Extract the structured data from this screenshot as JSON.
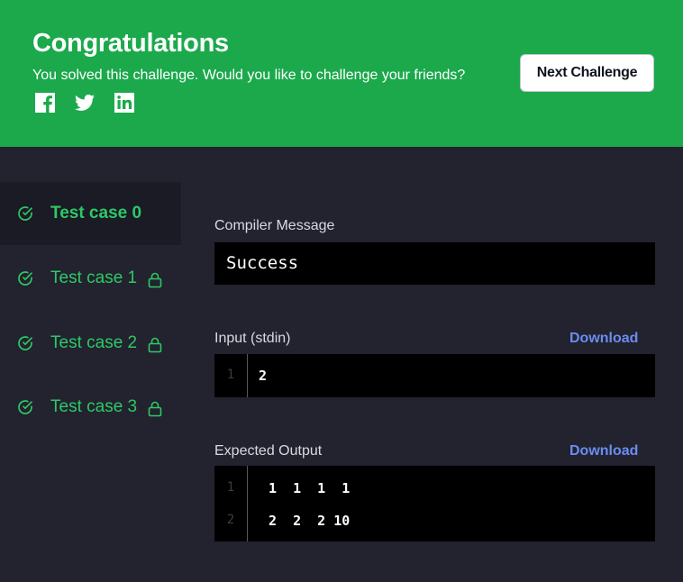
{
  "banner": {
    "title": "Congratulations",
    "subtitle": "You solved this challenge. Would you like to challenge your friends?",
    "share": [
      "facebook-icon",
      "twitter-icon",
      "linkedin-icon"
    ],
    "next_button": "Next Challenge",
    "color": "#1ba94c"
  },
  "test_cases": [
    {
      "label": "Test case 0",
      "locked": false,
      "passed": true
    },
    {
      "label": "Test case 1",
      "locked": true,
      "passed": true
    },
    {
      "label": "Test case 2",
      "locked": true,
      "passed": true
    },
    {
      "label": "Test case 3",
      "locked": true,
      "passed": true
    }
  ],
  "compiler": {
    "label": "Compiler Message",
    "message": "Success"
  },
  "input": {
    "label": "Input (stdin)",
    "download": "Download",
    "lines": [
      {
        "n": "1",
        "text": "2"
      }
    ]
  },
  "expected": {
    "label": "Expected Output",
    "download": "Download",
    "lines": [
      {
        "n": "1",
        "text": "1  1  1  1"
      },
      {
        "n": "2",
        "text": "2  2  2 10"
      }
    ]
  },
  "colors": {
    "accent_green": "#2ec866",
    "link_blue": "#6b8cf1",
    "background": "#22232e"
  }
}
